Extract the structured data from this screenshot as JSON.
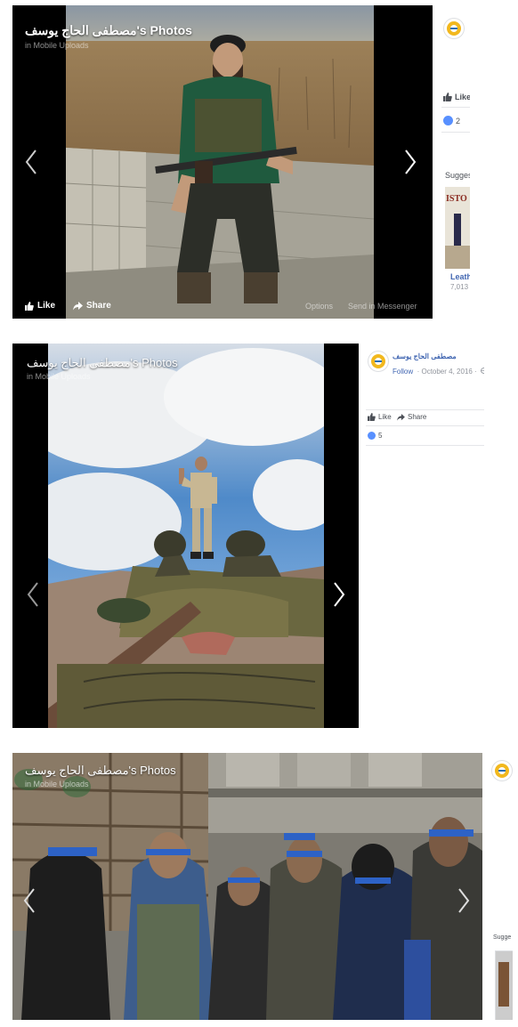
{
  "shots": [
    {
      "title": "مصطفى الحاج يوسف's Photos",
      "subtitle": "in Mobile Uploads",
      "actions": {
        "like": "Like",
        "share": "Share",
        "options": "Options",
        "send": "Send in Messenger"
      },
      "side": {
        "like": "Like",
        "like_count": "2",
        "suggested": "Sugges",
        "card_title": "Leath",
        "card_count": "7,013",
        "card_image_text": "ISTO"
      }
    },
    {
      "title": "مصطفى الحاج يوسف's Photos",
      "subtitle": "in Mobile Uploads",
      "side": {
        "author": "مصطفى الحاج يوسف",
        "follow": "Follow",
        "date": "· October 4, 2016 ·",
        "like": "Like",
        "share": "Share",
        "like_count": "5"
      }
    },
    {
      "title": "مصطفى الحاج يوسف's Photos",
      "subtitle": "in Mobile Uploads",
      "side": {
        "suggested": "Sugge"
      }
    }
  ],
  "colors": {
    "facebook_blue": "#4267b2",
    "like_blue": "#5890ff",
    "viewer_bg": "#000000"
  }
}
